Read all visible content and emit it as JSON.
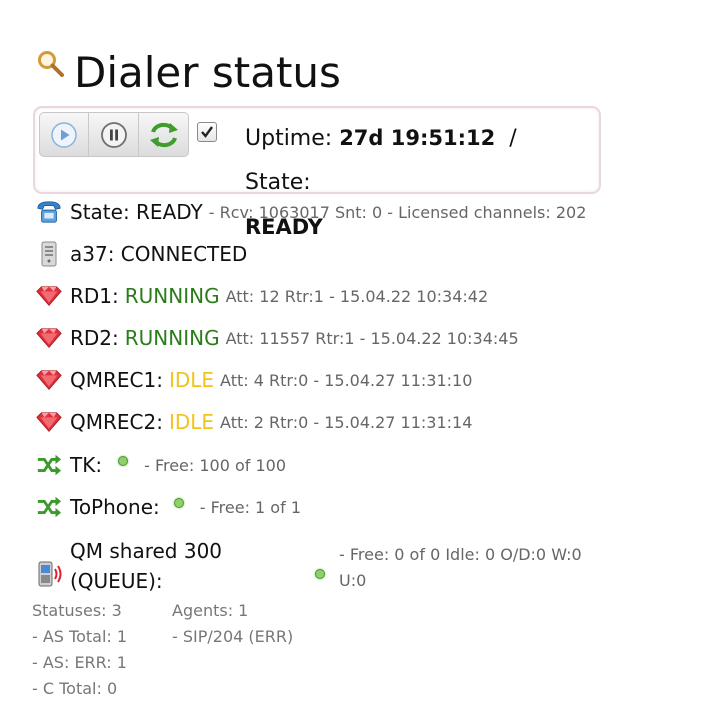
{
  "title": "Dialer status",
  "icons": {
    "title": "magnifier-icon"
  },
  "toolbar": {
    "buttons": [
      "play-button",
      "pause-button",
      "refresh-button"
    ],
    "checkbox_checked": true,
    "uptime_label": "Uptime:",
    "uptime_value": "27d 19:51:12",
    "separator": "/",
    "state_label": "State:",
    "state_value": "READY"
  },
  "rows": {
    "state": {
      "label": "State: READY",
      "detail": "- Rcv: 1063017 Snt: 0 - Licensed channels: 202"
    },
    "a37": {
      "label": "a37: CONNECTED"
    },
    "rd1": {
      "name": "RD1:",
      "status": "RUNNING",
      "detail": "Att: 12 Rtr:1 - 15.04.22 10:34:42"
    },
    "rd2": {
      "name": "RD2:",
      "status": "RUNNING",
      "detail": "Att: 11557 Rtr:1 - 15.04.22 10:34:45"
    },
    "qmrec1": {
      "name": "QMREC1:",
      "status": "IDLE",
      "detail": "Att: 4 Rtr:0 - 15.04.27 11:31:10"
    },
    "qmrec2": {
      "name": "QMREC2:",
      "status": "IDLE",
      "detail": "Att: 2 Rtr:0 - 15.04.27 11:31:14"
    },
    "tk": {
      "name": "TK:",
      "detail": "- Free: 100 of 100"
    },
    "tophone": {
      "name": "ToPhone:",
      "detail": "- Free: 1 of 1"
    },
    "qm": {
      "name_line1": "QM shared 300",
      "name_line2": "(QUEUE):",
      "detail_line1": "- Free: 0 of 0 Idle: 0 O/D:0 W:0",
      "detail_line2": "U:0"
    }
  },
  "stats": {
    "left": [
      "Statuses: 3",
      "- AS Total: 1",
      "- AS: ERR: 1",
      "- C Total: 0"
    ],
    "right": [
      "Agents: 1",
      "- SIP/204 (ERR)"
    ]
  },
  "colors": {
    "running": "#2a7d1a",
    "idle": "#f2c31c",
    "panel_border": "#ead6dc"
  }
}
